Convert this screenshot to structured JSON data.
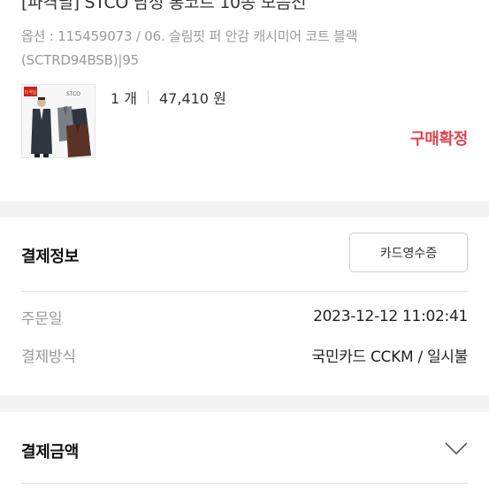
{
  "product": {
    "title": "[파격딜] STCO 남성 롱코트 10종 모음전",
    "option": "옵션 : 115459073 / 06. 슬림핏 퍼 안감 캐시미어 코트 블랙 (SCTRD94BSB)|95",
    "thumbnail_badge": "파격딜",
    "thumbnail_brand": "STCO",
    "quantity": "1 개",
    "price": "47,410 원",
    "status": "구매확정"
  },
  "payment_info": {
    "title": "결제정보",
    "receipt_button": "카드영수증",
    "rows": [
      {
        "label": "주문일",
        "value": "2023-12-12 11:02:41"
      },
      {
        "label": "결제방식",
        "value": "국민카드 CCKM / 일시불"
      }
    ]
  },
  "payment_amount": {
    "title": "결제금액",
    "toggle_icon": "chevron-down-icon"
  },
  "colors": {
    "status_red": "#e0434f",
    "band_gray": "#f3f3f3",
    "label_gray": "#9a9a9a"
  }
}
